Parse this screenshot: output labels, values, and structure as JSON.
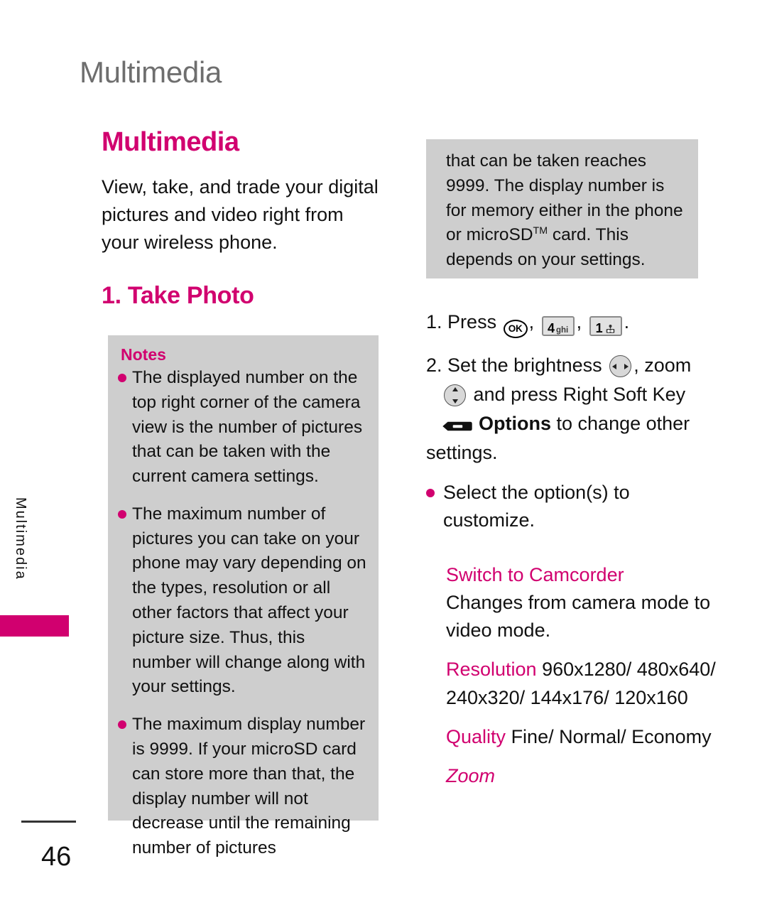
{
  "document": {
    "running_header": "Multimedia",
    "side_tab_label": "Multimedia",
    "page_number": "46"
  },
  "colors": {
    "accent_magenta": "#d1006f",
    "grey_box": "#cecece",
    "header_grey": "#6e6e6e",
    "body_text": "#111111"
  },
  "left_column": {
    "section_title": "Multimedia",
    "intro_paragraph": "View, take, and trade your digital pictures and video right from your wireless phone.",
    "sub_title": "1. Take Photo",
    "notes": {
      "title": "Notes",
      "items": [
        "The displayed number on the top right corner of the camera view is the number of pictures that can be taken with the current camera settings.",
        "The maximum number of pictures you can take on your phone may vary depending on the types, resolution or all other factors that affect your picture size. Thus, this number will change along with your settings.",
        "The maximum display number is 9999. If your microSD card can store more than that, the display number will not decrease until the remaining number of pictures"
      ]
    }
  },
  "right_column": {
    "continuation_box": {
      "line1": "that can be taken reaches 9999.",
      "line2": "The display number is for",
      "line3": "memory either in the phone or",
      "line4_pre": "microSD",
      "line4_tm": "TM",
      "line4_post": " card. This depends on",
      "line5": "your settings."
    },
    "steps": [
      {
        "number": "1.",
        "text_before": "Press",
        "keys": [
          {
            "type": "ok-key",
            "label": "OK"
          },
          {
            "type": "pad-key",
            "num": "4",
            "sub": "ghi"
          },
          {
            "type": "pad-key",
            "num": "1",
            "sub": "voicemail-icon"
          }
        ],
        "text_after": "."
      },
      {
        "number": "2.",
        "part1": "Set the brightness",
        "brightness_icon": "nav-left-right-icon",
        "part2": ", zoom",
        "zoom_icon": "nav-up-down-icon",
        "part3": "and press Right Soft Key",
        "softkey_icon": "soft-key-icon",
        "options_label": "Options",
        "part4": "to change other",
        "part5": "settings."
      }
    ],
    "bullet_step": "Select the option(s) to customize.",
    "options": [
      {
        "name": "Switch to Camcorder",
        "italic": false,
        "description": "Changes from camera mode to video mode."
      },
      {
        "name": "Resolution",
        "italic": false,
        "description": "960x1280/ 480x640/ 240x320/ 144x176/ 120x160"
      },
      {
        "name": "Quality",
        "italic": false,
        "description": "Fine/ Normal/ Economy"
      },
      {
        "name": "Zoom",
        "italic": true,
        "description": ""
      }
    ]
  }
}
